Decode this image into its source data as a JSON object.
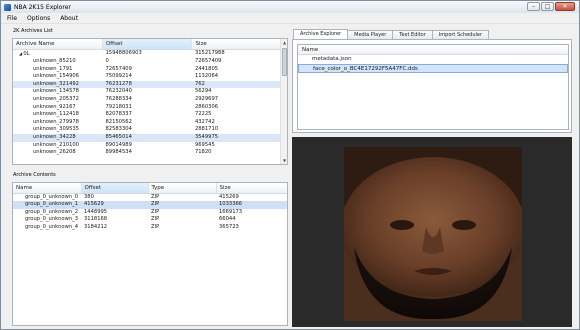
{
  "window": {
    "title": "NBA 2K15 Explorer",
    "controls": {
      "minimize": "–",
      "maximize": "□",
      "close": "✕"
    }
  },
  "menu": [
    "File",
    "Options",
    "About"
  ],
  "archives": {
    "group_label": "2K Archives List",
    "columns": [
      "Archive Name",
      "Offset",
      "Size"
    ],
    "rows": [
      {
        "name": "0L",
        "offset": "15948806903",
        "size": "315217988",
        "root": true
      },
      {
        "name": "unknown_85210",
        "offset": "0",
        "size": "72657409"
      },
      {
        "name": "unknown_1791",
        "offset": "72657409",
        "size": "2441805"
      },
      {
        "name": "unknown_154906",
        "offset": "75099214",
        "size": "1132064"
      },
      {
        "name": "unknown_321492",
        "offset": "76231278",
        "size": "762",
        "selected": true
      },
      {
        "name": "unknown_134578",
        "offset": "76232040",
        "size": "56294"
      },
      {
        "name": "unknown_205372",
        "offset": "76288334",
        "size": "2929697"
      },
      {
        "name": "unknown_92167",
        "offset": "79218031",
        "size": "2860306"
      },
      {
        "name": "unknown_112418",
        "offset": "82078337",
        "size": "72225"
      },
      {
        "name": "unknown_279978",
        "offset": "82150562",
        "size": "432742"
      },
      {
        "name": "unknown_309535",
        "offset": "82583304",
        "size": "2881710"
      },
      {
        "name": "unknown_34228",
        "offset": "85465014",
        "size": "3549975",
        "selected": true
      },
      {
        "name": "unknown_210100",
        "offset": "89014989",
        "size": "969545"
      },
      {
        "name": "unknown_26208",
        "offset": "89984534",
        "size": "71820"
      }
    ]
  },
  "contents": {
    "group_label": "Archive Contents",
    "columns": [
      "Name",
      "Offset",
      "Type",
      "Size"
    ],
    "rows": [
      {
        "name": "group_0_unknown_0",
        "offset": "380",
        "type": "ZIP",
        "size": "415269"
      },
      {
        "name": "group_0_unknown_1",
        "offset": "415629",
        "type": "ZIP",
        "size": "1033366",
        "selected": true
      },
      {
        "name": "group_0_unknown_2",
        "offset": "1448995",
        "type": "ZIP",
        "size": "1669173"
      },
      {
        "name": "group_0_unknown_3",
        "offset": "3118168",
        "type": "ZIP",
        "size": "66044"
      },
      {
        "name": "group_0_unknown_4",
        "offset": "3184212",
        "type": "ZIP",
        "size": "365723"
      }
    ]
  },
  "tabs": [
    "Archive Explorer",
    "Media Player",
    "Text Editor",
    "Import Scheduler"
  ],
  "explorer": {
    "column": "Name",
    "files": [
      {
        "name": "metadata.json"
      },
      {
        "name": "face_color_o_BC4E17292F5A47FC.dds",
        "selected": true
      }
    ]
  },
  "colors": {
    "selection": "#dbe7f6",
    "sorted_header": "#cfe4f5",
    "preview_bg": "#2a2a2a"
  }
}
